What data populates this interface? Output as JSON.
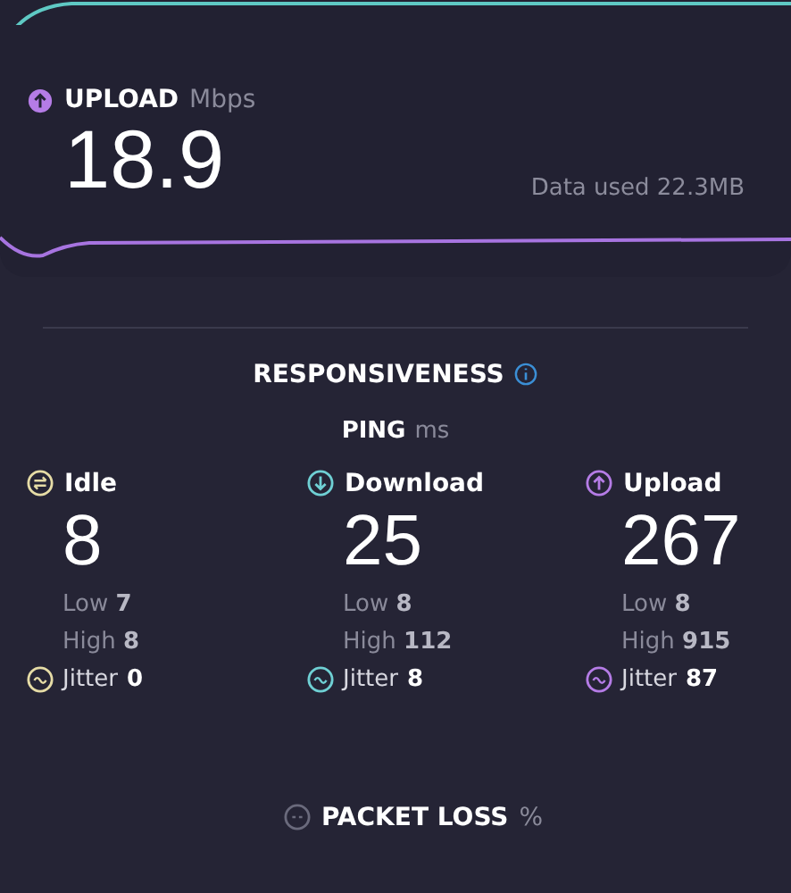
{
  "upload": {
    "label": "UPLOAD",
    "unit": "Mbps",
    "value": "18.9",
    "data_used": "Data used 22.3MB"
  },
  "responsiveness": {
    "title": "RESPONSIVENESS",
    "ping_label": "PING",
    "ping_unit": "ms",
    "columns": [
      {
        "kind": "idle",
        "label": "Idle",
        "value": "8",
        "low_label": "Low",
        "low": "7",
        "high_label": "High",
        "high": "8",
        "jitter_label": "Jitter",
        "jitter": "0",
        "color": "#e6dca6"
      },
      {
        "kind": "download",
        "label": "Download",
        "value": "25",
        "low_label": "Low",
        "low": "8",
        "high_label": "High",
        "high": "112",
        "jitter_label": "Jitter",
        "jitter": "8",
        "color": "#6fd0d4"
      },
      {
        "kind": "upload",
        "label": "Upload",
        "value": "267",
        "low_label": "Low",
        "low": "8",
        "high_label": "High",
        "high": "915",
        "jitter_label": "Jitter",
        "jitter": "87",
        "color": "#b57ce6"
      }
    ]
  },
  "packet_loss": {
    "label": "PACKET LOSS",
    "unit": "%"
  }
}
